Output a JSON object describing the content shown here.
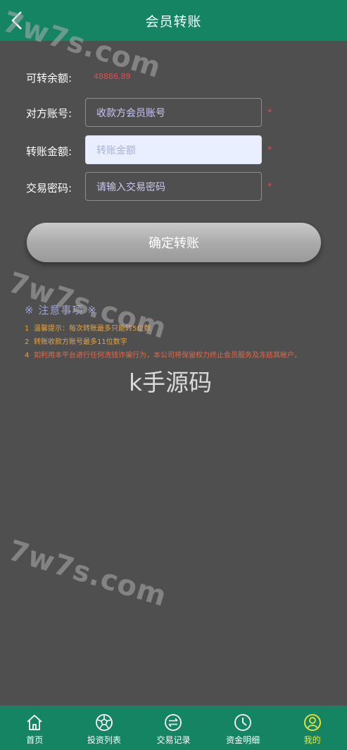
{
  "header": {
    "title": "会员转账",
    "back_icon": "chevron-left-icon"
  },
  "form": {
    "balance_label": "可转余额:",
    "balance_value": "48886.89",
    "account_label": "对方账号:",
    "account_placeholder": "收款方会员账号",
    "amount_label": "转账金额:",
    "amount_placeholder": "转账金额",
    "password_label": "交易密码:",
    "password_placeholder": "请输入交易密码",
    "required_mark": "*",
    "submit_label": "确定转账"
  },
  "notice": {
    "title": "※ 注意事项 ※",
    "items": [
      {
        "num": "1",
        "text": "温馨提示：每次转账最多只能转5位数"
      },
      {
        "num": "2",
        "text": "转账收款方账号最多11位数字"
      },
      {
        "num": "4",
        "text": "如利用本平台进行任何洗钱诈骗行为，本公司将保留权力终止会员服务及冻结其帐户。"
      }
    ]
  },
  "watermarks": {
    "site": "7w7s.com",
    "brand": "k手源码"
  },
  "tabbar": {
    "items": [
      {
        "label": "首页",
        "icon": "home-icon"
      },
      {
        "label": "投资列表",
        "icon": "soccer-ball-icon"
      },
      {
        "label": "交易记录",
        "icon": "transfer-arrows-icon"
      },
      {
        "label": "资金明细",
        "icon": "clock-icon"
      },
      {
        "label": "我的",
        "icon": "user-icon"
      }
    ],
    "active_index": 4
  },
  "colors": {
    "header_bg": "#158463",
    "page_bg": "#4f4f4f",
    "balance": "#e84a4a",
    "active_tab": "#f2e73a"
  }
}
